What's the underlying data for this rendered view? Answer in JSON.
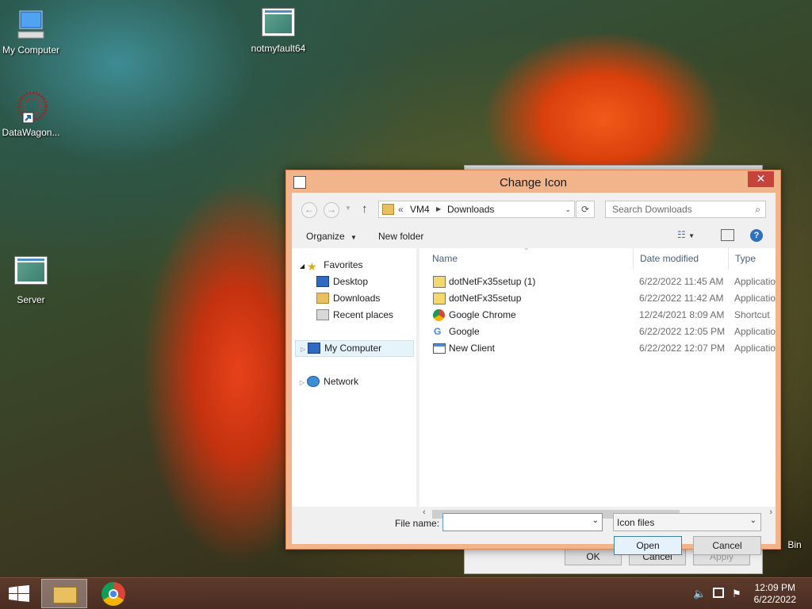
{
  "desktop": {
    "icons": [
      {
        "label": "My Computer"
      },
      {
        "label": "notmyfault64"
      },
      {
        "label": "DataWagon..."
      },
      {
        "label": "Server"
      },
      {
        "label": "Bin"
      }
    ]
  },
  "back_dialog": {
    "ok": "OK",
    "cancel": "Cancel",
    "apply": "Apply"
  },
  "dialog": {
    "title": "Change Icon",
    "close_glyph": "✕",
    "address": {
      "prefix": "«",
      "seg1": "VM4",
      "seg2": "Downloads"
    },
    "search_placeholder": "Search Downloads",
    "toolbar": {
      "organize": "Organize",
      "new_folder": "New folder"
    },
    "nav": {
      "favorites": "Favorites",
      "items": [
        "Desktop",
        "Downloads",
        "Recent places"
      ],
      "my_computer": "My Computer",
      "network": "Network"
    },
    "columns": [
      "Name",
      "Date modified",
      "Type"
    ],
    "files": [
      {
        "name": "dotNetFx35setup (1)",
        "date": "6/22/2022 11:45 AM",
        "type": "Application"
      },
      {
        "name": "dotNetFx35setup",
        "date": "6/22/2022 11:42 AM",
        "type": "Application"
      },
      {
        "name": "Google Chrome",
        "date": "12/24/2021 8:09 AM",
        "type": "Shortcut"
      },
      {
        "name": "Google",
        "date": "6/22/2022 12:05 PM",
        "type": "Application"
      },
      {
        "name": "New Client",
        "date": "6/22/2022 12:07 PM",
        "type": "Application"
      }
    ],
    "file_name_label": "File name:",
    "file_name_value": "",
    "file_type": "Icon files",
    "open": "Open",
    "cancel": "Cancel"
  },
  "taskbar": {
    "time": "12:09 PM",
    "date": "6/22/2022"
  }
}
